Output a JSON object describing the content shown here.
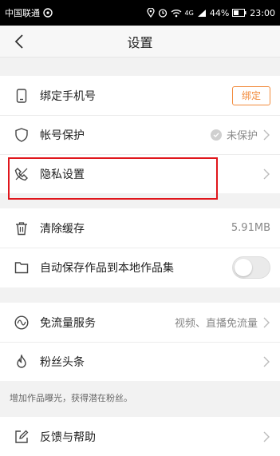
{
  "status_bar": {
    "carrier": "中国联通",
    "battery": "44%",
    "time": "23:00",
    "signal_label": "4G"
  },
  "header": {
    "title": "设置"
  },
  "group1": {
    "phone": {
      "label": "绑定手机号",
      "button": "绑定"
    },
    "account": {
      "label": "帐号保护",
      "status": "未保护"
    },
    "privacy": {
      "label": "隐私设置"
    }
  },
  "group2": {
    "cache": {
      "label": "清除缓存",
      "value": "5.91MB"
    },
    "autosave": {
      "label": "自动保存作品到本地作品集"
    }
  },
  "group3": {
    "traffic": {
      "label": "免流量服务",
      "value": "视频、直播免流量"
    },
    "fans": {
      "label": "粉丝头条"
    }
  },
  "tip": "增加作品曝光，获得潜在粉丝。",
  "group4": {
    "feedback": {
      "label": "反馈与帮助"
    }
  },
  "colors": {
    "accent": "#f28b3c",
    "highlight": "#e0161c"
  }
}
